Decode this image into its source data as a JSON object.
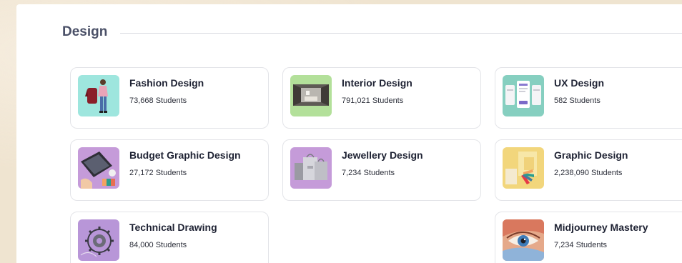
{
  "section": {
    "title": "Design"
  },
  "courses": [
    {
      "title": "Fashion Design",
      "students": "73,668 Students",
      "thumb_color": "#9ee6de",
      "icon": "fashion-model-thumbnail-icon"
    },
    {
      "title": "Interior Design",
      "students": "791,021 Students",
      "thumb_color": "#b3e09a",
      "icon": "interior-room-thumbnail-icon"
    },
    {
      "title": "UX Design",
      "students": "582 Students",
      "thumb_color": "#86cfc0",
      "icon": "ux-screens-thumbnail-icon"
    },
    {
      "title": "Budget Graphic Design",
      "students": "27,172 Students",
      "thumb_color": "#c59bd9",
      "icon": "laptop-desk-thumbnail-icon"
    },
    {
      "title": "Jewellery Design",
      "students": "7,234 Students",
      "thumb_color": "#c59bd9",
      "icon": "shopping-bags-thumbnail-icon"
    },
    {
      "title": "Graphic Design",
      "students": "2,238,090 Students",
      "thumb_color": "#f2d67c",
      "icon": "color-swatch-thumbnail-icon"
    },
    {
      "title": "Technical Drawing",
      "students": "84,000 Students",
      "thumb_color": "#b896d8",
      "icon": "gear-sketch-thumbnail-icon"
    },
    {
      "title": "Midjourney Mastery",
      "students": "7,234 Students",
      "thumb_color": "#e5a98a",
      "icon": "painted-eye-thumbnail-icon"
    }
  ]
}
